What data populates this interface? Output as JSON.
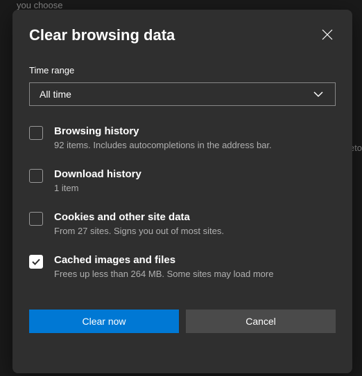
{
  "background": {
    "text1": "you choose",
    "text2": "eto"
  },
  "dialog": {
    "title": "Clear browsing data",
    "timeRangeLabel": "Time range",
    "timeRangeValue": "All time",
    "options": [
      {
        "title": "Browsing history",
        "desc": "92 items. Includes autocompletions in the address bar.",
        "checked": false
      },
      {
        "title": "Download history",
        "desc": "1 item",
        "checked": false
      },
      {
        "title": "Cookies and other site data",
        "desc": "From 27 sites. Signs you out of most sites.",
        "checked": false
      },
      {
        "title": "Cached images and files",
        "desc": "Frees up less than 264 MB. Some sites may load more",
        "checked": true
      }
    ],
    "primaryButton": "Clear now",
    "secondaryButton": "Cancel"
  }
}
